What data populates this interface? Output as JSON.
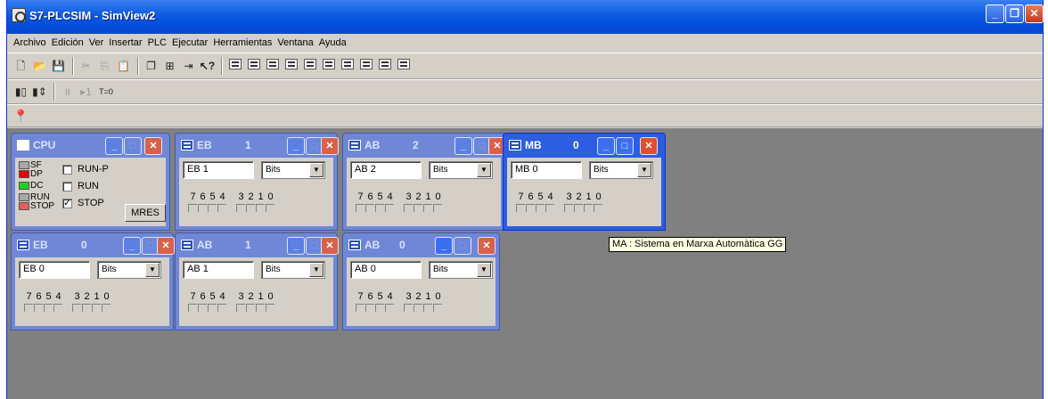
{
  "app": {
    "title": "S7-PLCSIM - SimView2"
  },
  "menu": [
    "Archivo",
    "Edición",
    "Ver",
    "Insertar",
    "PLC",
    "Ejecutar",
    "Herramientas",
    "Ventana",
    "Ayuda"
  ],
  "toolbar": {
    "t_zero": "T=0"
  },
  "cpu": {
    "title": "CPU",
    "leds": [
      {
        "label": "SF",
        "color": "#a8a8a8"
      },
      {
        "label": "DP",
        "color": "#e00000"
      },
      {
        "label": "DC",
        "color": "#20d020"
      },
      {
        "label": "RUN",
        "color": "#a8a8a8"
      },
      {
        "label": "STOP",
        "color": "#e06060"
      }
    ],
    "modes": [
      {
        "label": "RUN-P",
        "checked": false
      },
      {
        "label": "RUN",
        "checked": false
      },
      {
        "label": "STOP",
        "checked": true
      }
    ],
    "mres_label": "MRES"
  },
  "windows": [
    {
      "name": "EB",
      "num": "1",
      "address": "EB   1",
      "format": "Bits"
    },
    {
      "name": "AB",
      "num": "2",
      "address": "AB   2",
      "format": "Bits"
    },
    {
      "name": "MB",
      "num": "0",
      "address": "MB   0",
      "format": "Bits"
    },
    {
      "name": "EB",
      "num": "0",
      "address": "EB   0",
      "format": "Bits"
    },
    {
      "name": "AB",
      "num": "1",
      "address": "AB   1",
      "format": "Bits"
    },
    {
      "name": "AB",
      "num": "0",
      "address": "AB   0",
      "format": "Bits"
    }
  ],
  "bit_labels": [
    "7",
    "6",
    "5",
    "4",
    "3",
    "2",
    "1",
    "0"
  ],
  "tooltip": "MA : Sistema en Marxa Automàtica GG"
}
